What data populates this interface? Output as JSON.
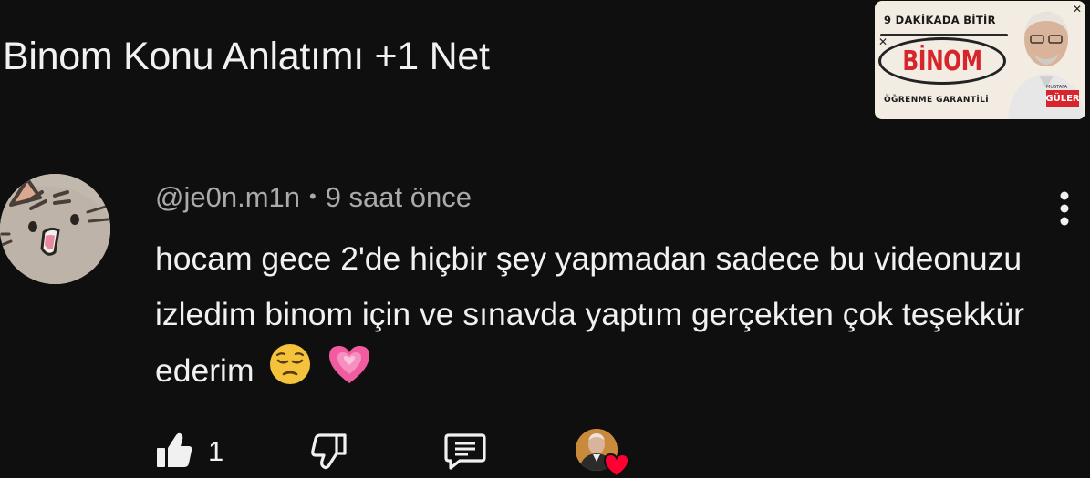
{
  "video": {
    "title": "Binom Konu Anlatımı +1 Net"
  },
  "thumbnail": {
    "top_text": "9 DAKİKADA BİTİR",
    "main_text": "BİNOM",
    "bottom_text": "ÖĞRENME GARANTİLİ",
    "badge_text": "GÜLER",
    "badge_small": "MUSTAFA",
    "accent_color": "#d8242b"
  },
  "comment": {
    "author": "@je0n.m1n",
    "separator": "•",
    "time": "9 saat önce",
    "text": "hocam gece 2'de hiçbir şey yapmadan sadece bu videonuzu izledim binom için ve sınavda yaptım gerçekten çok teşekkür ederim",
    "emojis": [
      "pensive-face",
      "growing-heart"
    ],
    "likes": "1"
  },
  "icons": {
    "like": "thumbs-up-icon",
    "dislike": "thumbs-down-icon",
    "reply": "comment-icon",
    "more": "vertical-dots-icon",
    "creator_heart": "heart-icon"
  },
  "colors": {
    "background": "#0f0f0f",
    "text": "#f1f1f1",
    "meta": "#aaaaaa",
    "heart": "#ff0033"
  }
}
